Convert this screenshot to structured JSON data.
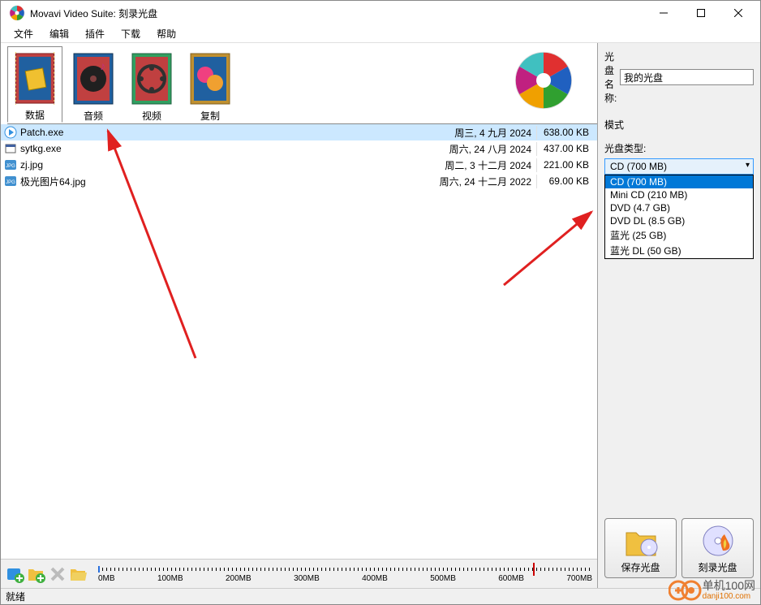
{
  "titlebar": {
    "text": "Movavi Video Suite: 刻录光盘"
  },
  "menu": {
    "items": [
      "文件",
      "编辑",
      "插件",
      "下载",
      "帮助"
    ]
  },
  "tabs": {
    "items": [
      "数据",
      "音频",
      "视频",
      "复制"
    ],
    "active": 0
  },
  "files": [
    {
      "name": "Patch.exe",
      "date": "周三, 4 九月 2024",
      "size": "638.00 KB",
      "icon": "play",
      "selected": true
    },
    {
      "name": "sytkg.exe",
      "date": "周六, 24 八月 2024",
      "size": "437.00 KB",
      "icon": "exe",
      "selected": false
    },
    {
      "name": "zj.jpg",
      "date": "周二, 3 十二月 2024",
      "size": "221.00 KB",
      "icon": "jpg",
      "selected": false
    },
    {
      "name": "极光图片64.jpg",
      "date": "周六, 24 十二月 2022",
      "size": "69.00 KB",
      "icon": "jpg",
      "selected": false
    }
  ],
  "capacity": {
    "ticks": [
      "0MB",
      "100MB",
      "200MB",
      "300MB",
      "400MB",
      "500MB",
      "600MB",
      "700MB"
    ],
    "fill_percent": 0.3,
    "marker_percent": 88
  },
  "right": {
    "disc_name_label": "光盘名称:",
    "disc_name_value": "我的光盘",
    "mode_label": "模式",
    "disc_type_label": "光盘类型:",
    "disc_type_selected": "CD (700 MB)",
    "disc_type_options": [
      "CD (700 MB)",
      "Mini CD (210 MB)",
      "DVD (4.7 GB)",
      "DVD DL (8.5 GB)",
      "蓝光 (25 GB)",
      "蓝光 DL (50 GB)"
    ],
    "disc_type_highlighted": 0,
    "save_button": "保存光盘",
    "burn_button": "刻录光盘"
  },
  "status": {
    "text": "就绪"
  },
  "watermark": {
    "line1": "单机100网",
    "line2": "danji100.com"
  }
}
